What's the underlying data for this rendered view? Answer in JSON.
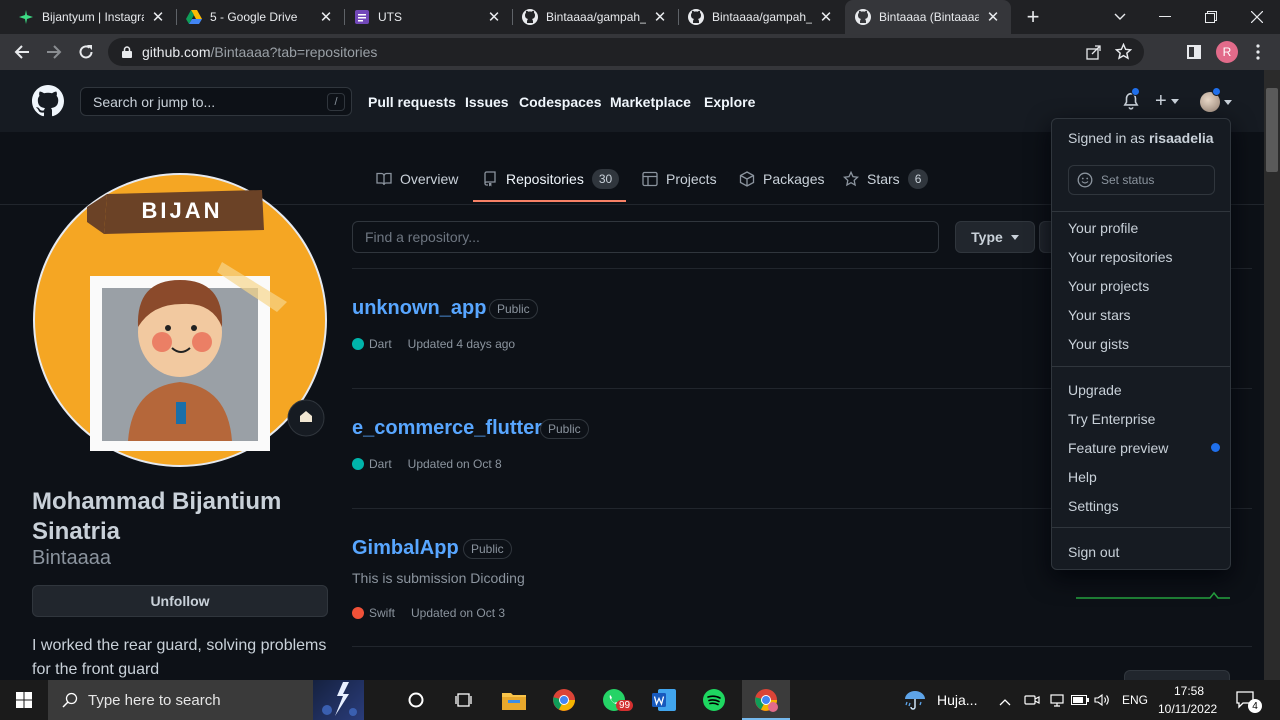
{
  "browser": {
    "tabs": [
      {
        "title": "Bijantyum | Instagra",
        "icon": "leaf-icon",
        "close": "✕"
      },
      {
        "title": "5 - Google Drive",
        "icon": "google-drive-icon",
        "close": "✕"
      },
      {
        "title": "UTS",
        "icon": "forms-icon",
        "close": "✕"
      },
      {
        "title": "Bintaaaa/gampah_r",
        "icon": "github-icon",
        "close": "✕"
      },
      {
        "title": "Bintaaaa/gampah_l",
        "icon": "github-icon",
        "close": "✕"
      },
      {
        "title": "Bintaaaa (Bintaaaa)",
        "icon": "github-icon",
        "close": "✕"
      }
    ],
    "new_tab": "+",
    "url_host": "github.com",
    "url_path": "/Bintaaaa?tab=repositories",
    "profile_initial": "R"
  },
  "github": {
    "search_placeholder": "Search or jump to...",
    "search_key": "/",
    "nav": [
      "Pull requests",
      "Issues",
      "Codespaces",
      "Marketplace",
      "Explore"
    ],
    "plus": "+"
  },
  "profile_tabs": [
    {
      "label": "Overview"
    },
    {
      "label": "Repositories",
      "count": "30"
    },
    {
      "label": "Projects"
    },
    {
      "label": "Packages"
    },
    {
      "label": "Stars",
      "count": "6"
    }
  ],
  "profile": {
    "avatar_banner": "BIJAN",
    "full_name_line1": "Mohammad Bijantium",
    "full_name_line2": "Sinatria",
    "login": "Bintaaaa",
    "unfollow": "Unfollow",
    "bio_line1": "I worked the rear guard, solving problems",
    "bio_line2": "for the front guard"
  },
  "repo_filter": {
    "placeholder": "Find a repository...",
    "type_label": "Type"
  },
  "repos": [
    {
      "name": "unknown_app",
      "visibility": "Public",
      "description": "",
      "language": "Dart",
      "lang_color": "#00b4ab",
      "updated": "Updated 4 days ago"
    },
    {
      "name": "e_commerce_flutter",
      "visibility": "Public",
      "description": "",
      "language": "Dart",
      "lang_color": "#00b4ab",
      "updated": "Updated on Oct 8"
    },
    {
      "name": "GimbalApp",
      "visibility": "Public",
      "description": "This is submission Dicoding",
      "language": "Swift",
      "lang_color": "#f05138",
      "updated": "Updated on Oct 3"
    }
  ],
  "user_menu": {
    "signed_in_prefix": "Signed in as ",
    "username": "risaadelia",
    "set_status": "Set status",
    "group1": [
      "Your profile",
      "Your repositories",
      "Your projects",
      "Your stars",
      "Your gists"
    ],
    "group2": [
      "Upgrade",
      "Try Enterprise",
      "Feature preview",
      "Help",
      "Settings"
    ],
    "sign_out": "Sign out"
  },
  "taskbar": {
    "search_placeholder": "Type here to search",
    "whatsapp_badge": "99",
    "weather": "Huja...",
    "lang": "ENG",
    "time": "17:58",
    "date": "10/11/2022",
    "notifications": "4"
  }
}
